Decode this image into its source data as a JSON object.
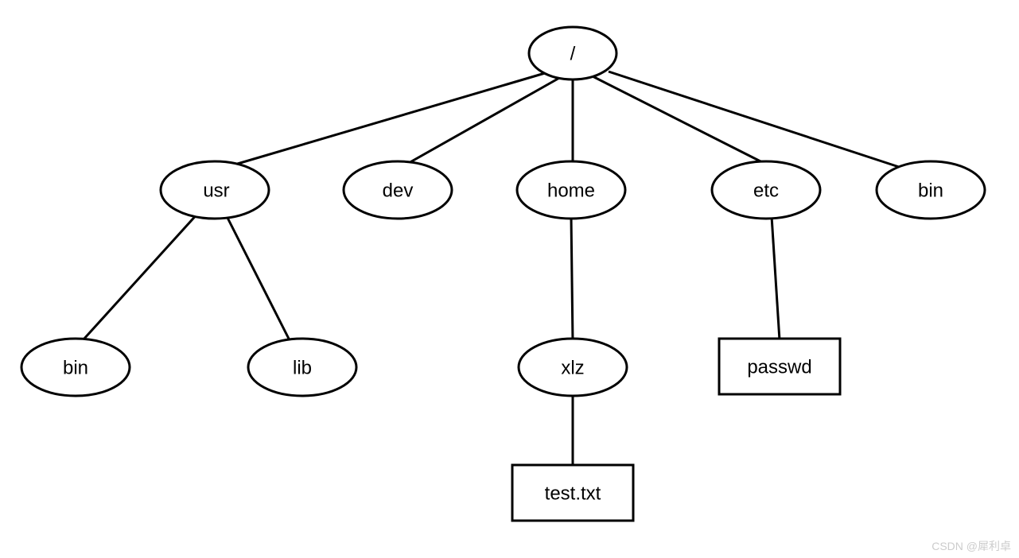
{
  "tree": {
    "root": {
      "label": "/",
      "type": "dir"
    },
    "level1": {
      "usr": {
        "label": "usr",
        "type": "dir"
      },
      "dev": {
        "label": "dev",
        "type": "dir"
      },
      "home": {
        "label": "home",
        "type": "dir"
      },
      "etc": {
        "label": "etc",
        "type": "dir"
      },
      "bin": {
        "label": "bin",
        "type": "dir"
      }
    },
    "level2": {
      "usr_bin": {
        "label": "bin",
        "type": "dir"
      },
      "usr_lib": {
        "label": "lib",
        "type": "dir"
      },
      "home_xlz": {
        "label": "xlz",
        "type": "dir"
      },
      "etc_passwd": {
        "label": "passwd",
        "type": "file"
      }
    },
    "level3": {
      "home_xlz_test": {
        "label": "test.txt",
        "type": "file"
      }
    }
  },
  "watermark": "CSDN @犀利卓"
}
